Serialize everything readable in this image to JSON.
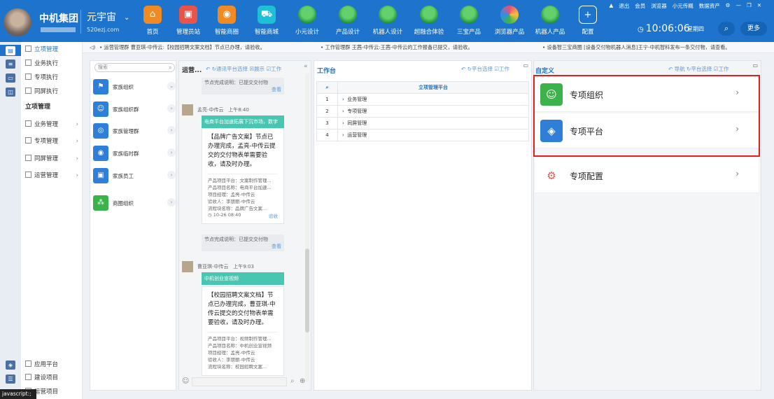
{
  "header": {
    "company": "中机集团",
    "brand": "元宇宙",
    "brand_url": "520ezj.com",
    "nav": [
      {
        "label": "首页",
        "icon": "home-icon"
      },
      {
        "label": "管理员站",
        "icon": "admin-station-icon"
      },
      {
        "label": "智能商圈",
        "icon": "smart-business-icon"
      },
      {
        "label": "智能商城",
        "icon": "smart-mall-icon"
      },
      {
        "label": "小元设计",
        "icon": "xiaoyuan-design-icon"
      },
      {
        "label": "产品设计",
        "icon": "product-design-icon"
      },
      {
        "label": "机器人设计",
        "icon": "robot-design-icon"
      },
      {
        "label": "超融合体验",
        "icon": "hyper-fusion-icon"
      },
      {
        "label": "三宝产品",
        "icon": "sanbao-product-icon"
      },
      {
        "label": "浏览器产品",
        "icon": "browser-product-icon"
      },
      {
        "label": "机器人产品",
        "icon": "robot-product-icon"
      },
      {
        "label": "配置",
        "icon": "config-plus-icon"
      }
    ],
    "top_links": [
      "退出",
      "会员",
      "浏览器",
      "小元传概",
      "数据资产"
    ],
    "time": "10:06:06",
    "weekday": "星期四",
    "more": "更多"
  },
  "notices": [
    "• 运营管理群 曹亚琪-中传云:【校园招聘文案文档】节点已办理，请验收。",
    "• 工作管理群 王茜-中传云:王茜-中传云的工作报备已提交，请验收。",
    "• 设备智三宝商圈 [设备交付物机器人消息]王宁-中机智科发布一条交付物，请查看。"
  ],
  "left_menu": {
    "top_items": [
      "立项管理",
      "业务执行",
      "专项执行",
      "同屏执行"
    ],
    "section_title": "立项管理",
    "sub_items": [
      "业务管理",
      "专项管理",
      "同屏管理",
      "运营管理"
    ],
    "bottom_items": [
      "应用平台",
      "建设项目",
      "运营项目"
    ]
  },
  "status_tip": "javascript:;",
  "contacts": {
    "search_placeholder": "搜索",
    "items": [
      "家族组织",
      "家族组织群",
      "家族管理群",
      "家族临时群",
      "家族员工",
      "商圈组织"
    ]
  },
  "chat": {
    "title": "运营...",
    "tools": "↶ ↻通讯平台选择 ☒展示 ☑工作",
    "msg1_sys": "节点完成说明：已提交交付物",
    "view": "查看",
    "msg2_user": "孟亮-中传云",
    "msg2_time": "上午8:40",
    "msg2_banner": "电商平台加速拓展下沉市场，数字",
    "msg2_body": "【品牌广告文案】节点已办理完成，孟亮-中传云提交的交付物表单需要验收，请及时办理。",
    "msg2_meta": [
      "产品项目平台：文案制作管理...",
      "产品项目名称：电商平台加速...",
      "项目经理：孟亮-中传云",
      "验收人：李朋丽-中传云",
      "流程块名称：品牌广告文案..."
    ],
    "msg2_date": "10-26 08:40",
    "accept": "验收",
    "msg3_sys": "节点完成说明：已提交交付物",
    "msg4_user": "曹亚琪-中传云",
    "msg4_time": "上午9:03",
    "msg4_banner": "中机创业宣视频",
    "msg4_body": "【校园招聘文案文档】节点已办理完成，曹亚琪-中传云提交的交付物表单需要验收，请及时办理。",
    "msg4_meta": [
      "产品项目平台：视频制作管理...",
      "产品项目名称：中机创业宣视频",
      "项目经理：孟亮-中传云",
      "验收人：李朋丽-中传云",
      "流程块名称：校园招聘文案..."
    ]
  },
  "workbench": {
    "title": "工作台",
    "tools": "↶ ↻平台选择 ☑工作",
    "table_header": "立项管理平台",
    "rows": [
      {
        "num": "1",
        "label": "业务管理"
      },
      {
        "num": "2",
        "label": "专项管理"
      },
      {
        "num": "3",
        "label": "同屏管理"
      },
      {
        "num": "4",
        "label": "运营管理"
      }
    ]
  },
  "custom": {
    "title": "自定义",
    "tools": "↶ 导航 ↻平台选择 ☑工作",
    "items": [
      "专项组织",
      "专项平台",
      "专项配置"
    ]
  },
  "colors": {
    "topbar": "#1e74cc",
    "accent_green": "#47c6b2",
    "highlight": "#e02020"
  }
}
